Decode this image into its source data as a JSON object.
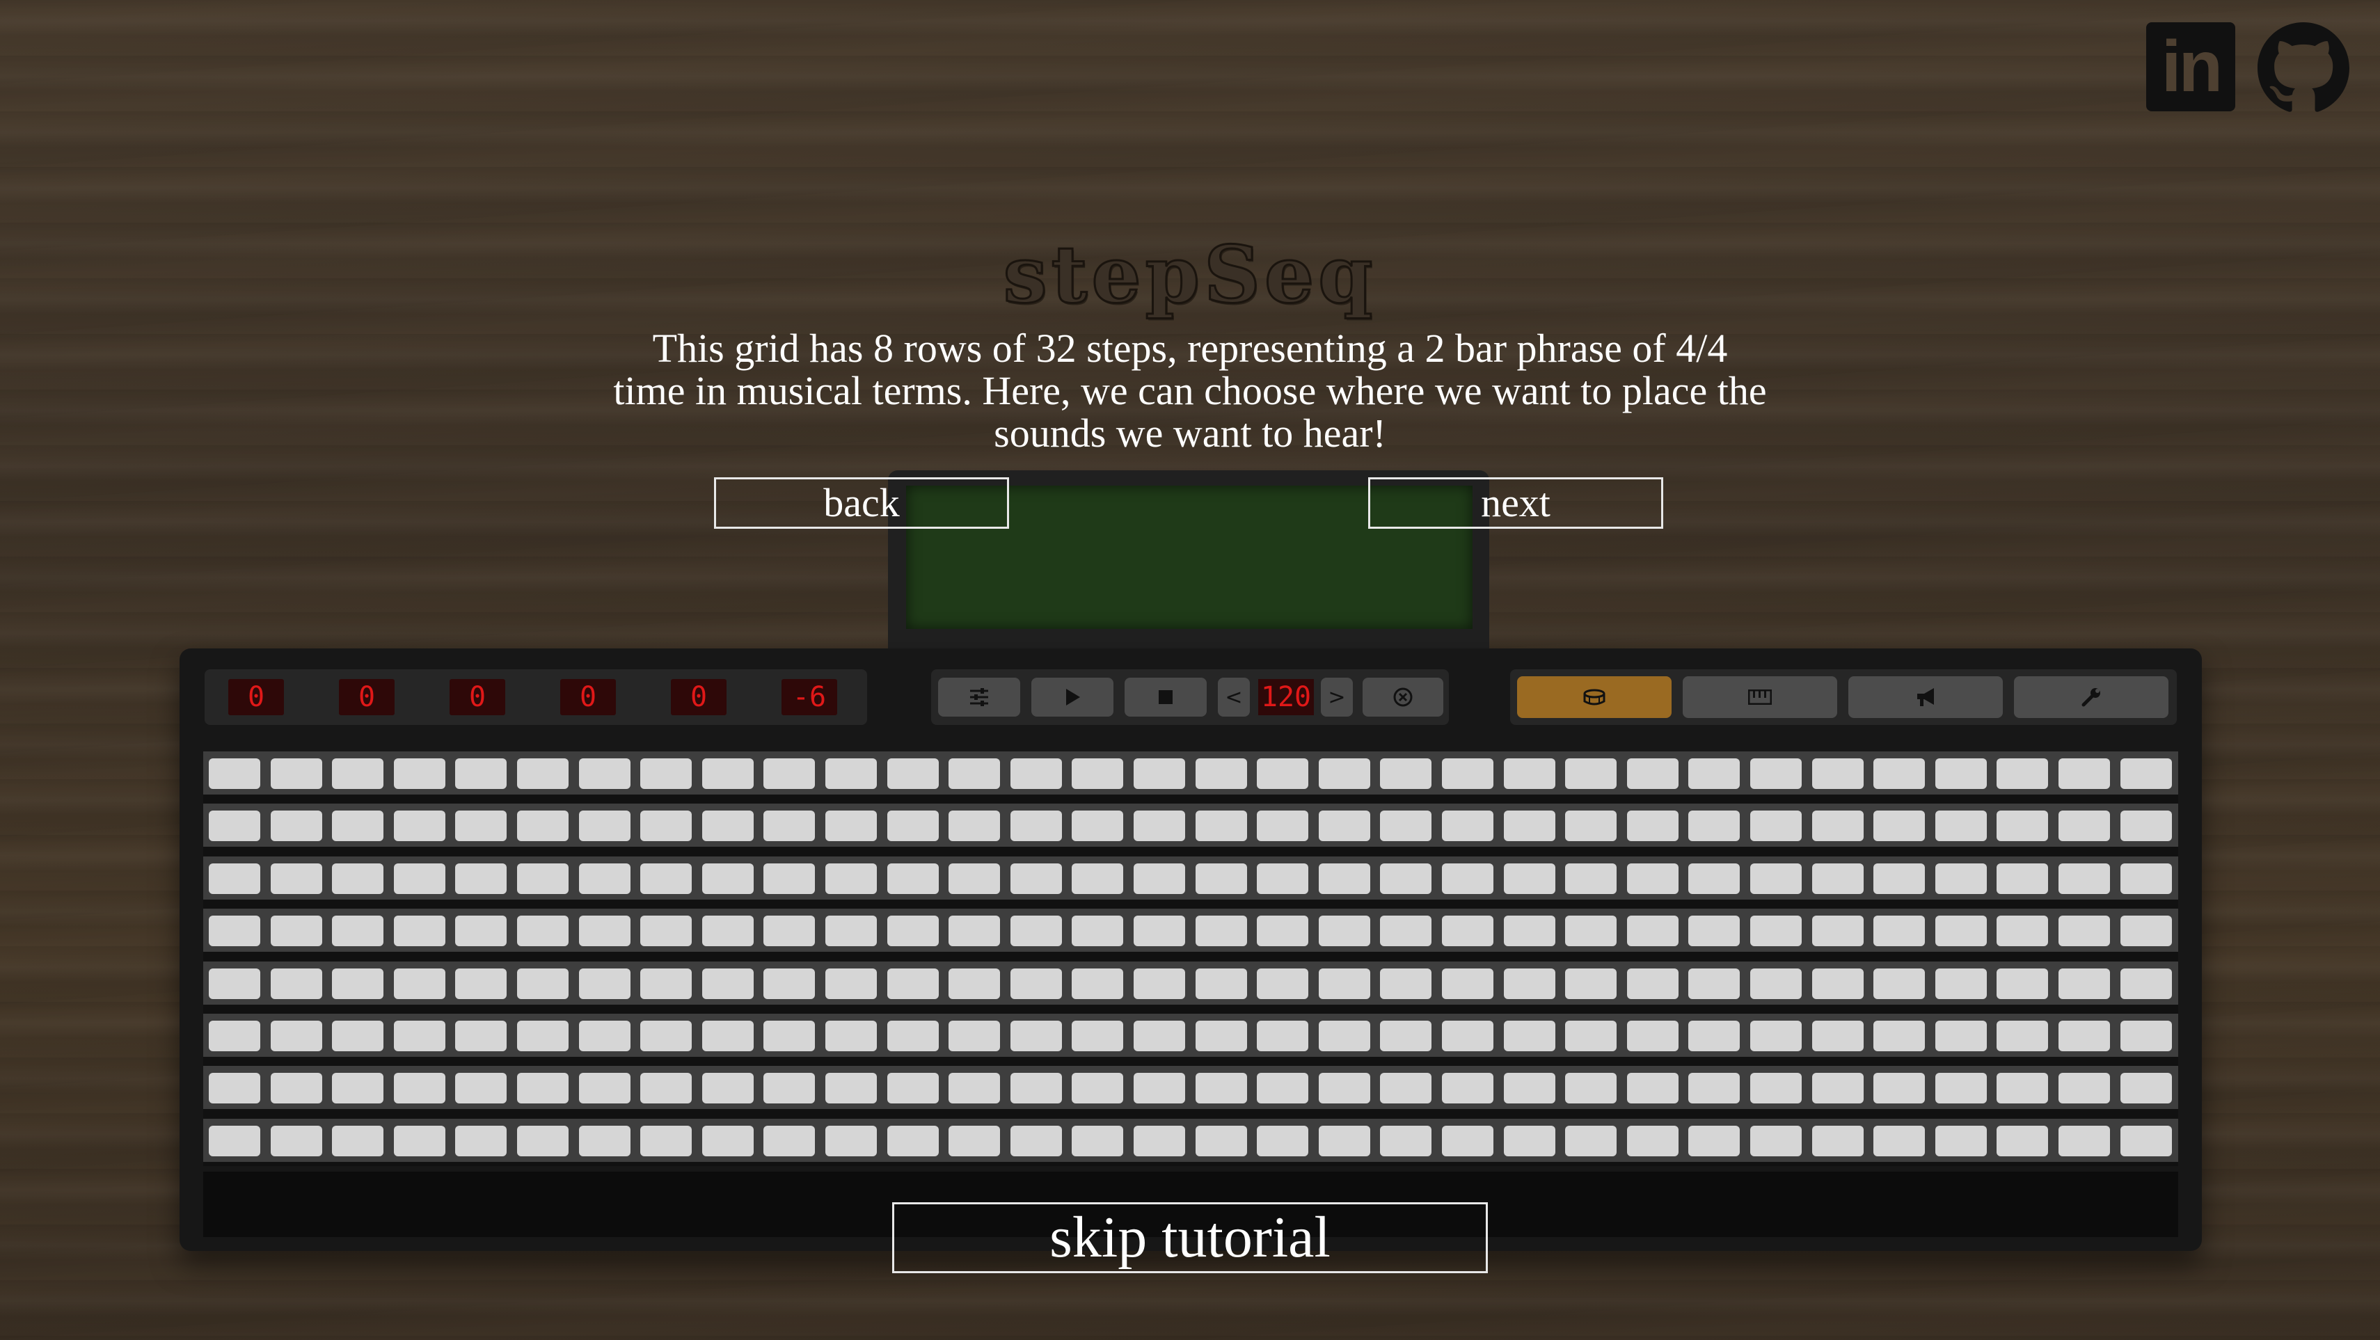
{
  "app": {
    "title": "stepSeq"
  },
  "tutorial": {
    "text": "This grid has 8 rows of 32 steps, representing a 2 bar phrase of 4/4 time in musical terms. Here, we can choose where we want to place the sounds we want to hear!",
    "back_label": "back",
    "next_label": "next",
    "skip_label": "skip tutorial"
  },
  "links": {
    "linkedin_label": "in"
  },
  "displays": [
    "0",
    "0",
    "0",
    "0",
    "0",
    "-6"
  ],
  "transport": {
    "tempo": "120",
    "prev_label": "<",
    "next_label": ">"
  },
  "modes": [
    {
      "icon": "drum-icon",
      "active": true
    },
    {
      "icon": "keyboard-icon",
      "active": false
    },
    {
      "icon": "megaphone-icon",
      "active": false
    },
    {
      "icon": "wrench-icon",
      "active": false
    }
  ],
  "grid": {
    "rows": 8,
    "steps": 32
  },
  "colors": {
    "accent": "#9a6a22",
    "display_red": "#e01818",
    "screen_green": "#1f3a18",
    "step_off": "#d6d6d6"
  }
}
